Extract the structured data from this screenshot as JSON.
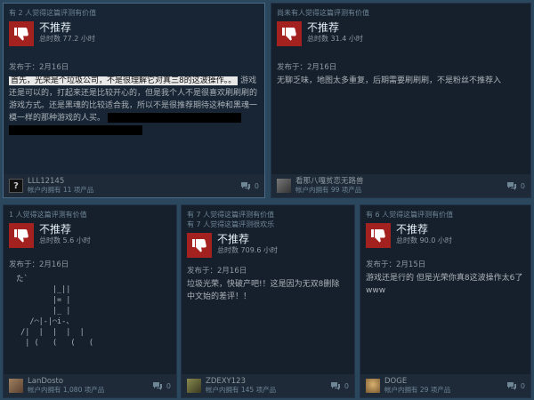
{
  "reviews": [
    {
      "helpful": [
        "有 2 人觉得这篇评测有价值"
      ],
      "verdict": "不推荐",
      "hours": "总时数 77.2 小时",
      "posted": "发布于：2月16日",
      "text_highlight": "首先，光荣是个垃圾公司，不是很理解它对真三8的这波操作。。",
      "text": "游戏还是可以的，打起来还是比较开心的，但是我个人不是很喜欢刷刷刷的游戏方式。还是黑魂的比较适合我，所以不是很推荐期待这种和黑魂一模一样的那种游戏的人买。",
      "user": "LLL12145",
      "products": "帐户内拥有 11 项产品",
      "comments": "0",
      "avatar": "question"
    },
    {
      "helpful": [
        "尚未有人觉得这篇评测有价值"
      ],
      "verdict": "不推荐",
      "hours": "总时数 31.4 小时",
      "posted": "发布于：2月16日",
      "text": "无聊乏味，地图太多重复，后期需要刷刷刷，不是粉丝不推荐入",
      "user": "看那八嘎贫恋无路兽",
      "products": "帐户内拥有 99 项产品",
      "comments": "0",
      "avatar": "gray"
    },
    {
      "helpful": [
        "1 人觉得这篇评测有价值"
      ],
      "verdict": "不推荐",
      "hours": "总时数 5.6 小时",
      "posted": "发布于：2月16日",
      "ascii": "た`\n        |_||\n        |= |\n        |_ |\n   /⌒|-|⌒i-、\n /|  |  |  |  |\n  | (   (   (   (",
      "user": "LanDosto",
      "products": "帐户内拥有 1,080 项产品",
      "comments": "0",
      "avatar": "brown"
    },
    {
      "helpful": [
        "有 7 人觉得这篇评测有价值",
        "有 7 人觉得这篇评测很欢乐"
      ],
      "verdict": "不推荐",
      "hours": "总时数 709.6 小时",
      "posted": "发布于：2月16日",
      "text": "垃圾光荣，快破产吧!！这是因为无双8删除中文始的差评！！",
      "user": "ZDEXY123",
      "products": "帐户内拥有 145 项产品",
      "comments": "0",
      "avatar": "olive"
    },
    {
      "helpful": [
        "有 6 人觉得这篇评测有价值"
      ],
      "verdict": "不推荐",
      "hours": "总时数 90.0 小时",
      "posted": "发布于：2月15日",
      "text": "游戏还是行的 但是光荣你真8这波操作太6了www",
      "user": "DOGE",
      "products": "帐户内拥有 29 项产品",
      "comments": "0",
      "avatar": "doge"
    }
  ]
}
